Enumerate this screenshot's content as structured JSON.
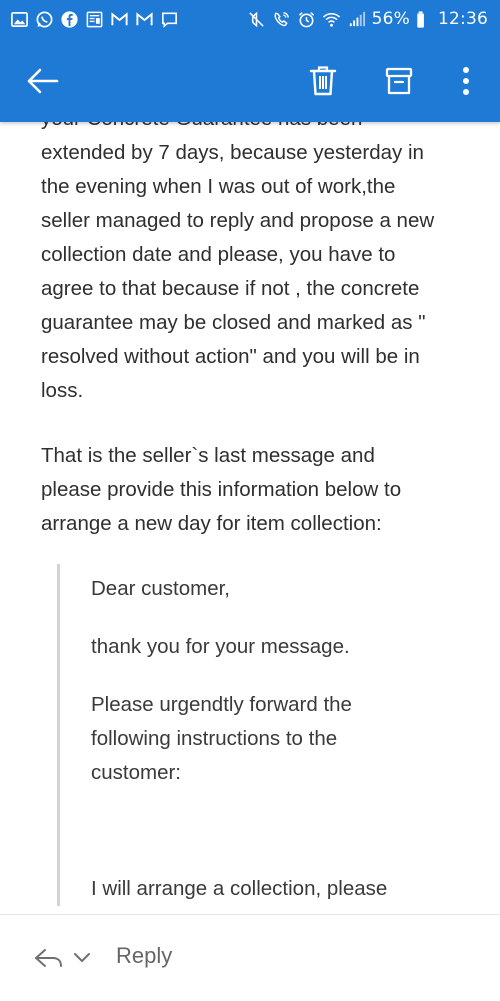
{
  "status_bar": {
    "battery": "56%",
    "time": "12:36",
    "left_icons": [
      "gallery-icon",
      "whatsapp-icon",
      "facebook-icon",
      "news-icon",
      "gmail-icon",
      "gmail-icon",
      "message-icon"
    ],
    "right_icons": [
      "mute-icon",
      "wifi-calling-icon",
      "alarm-icon",
      "wifi-icon",
      "signal-icon",
      "battery-icon"
    ]
  },
  "app_bar": {
    "color": "#1f7ad6",
    "actions": [
      "back-arrow-icon",
      "trash-icon",
      "archive-icon",
      "more-vertical-icon"
    ]
  },
  "email": {
    "partial_top_line": "your Concrete Guarantee has been",
    "paragraph_1": "extended by 7 days, because yesterday in\nthe evening when I was out of work,the\nseller managed to reply and propose a new\ncollection date and please, you have to\nagree to that because if not , the concrete\nguarantee may be closed and marked as \"\nresolved without action\" and you will be in\nloss.",
    "paragraph_2": "That is the seller`s last message and\nplease provide this information below to\narrange a new day for item collection:",
    "quote": {
      "line_1": "Dear customer,",
      "line_2": "thank you for your message.",
      "line_3": "Please urgendtly forward the\nfollowing instructions to the\ncustomer:",
      "line_4": "I will arrange a collection, please"
    }
  },
  "reply_bar": {
    "label": "Reply"
  }
}
